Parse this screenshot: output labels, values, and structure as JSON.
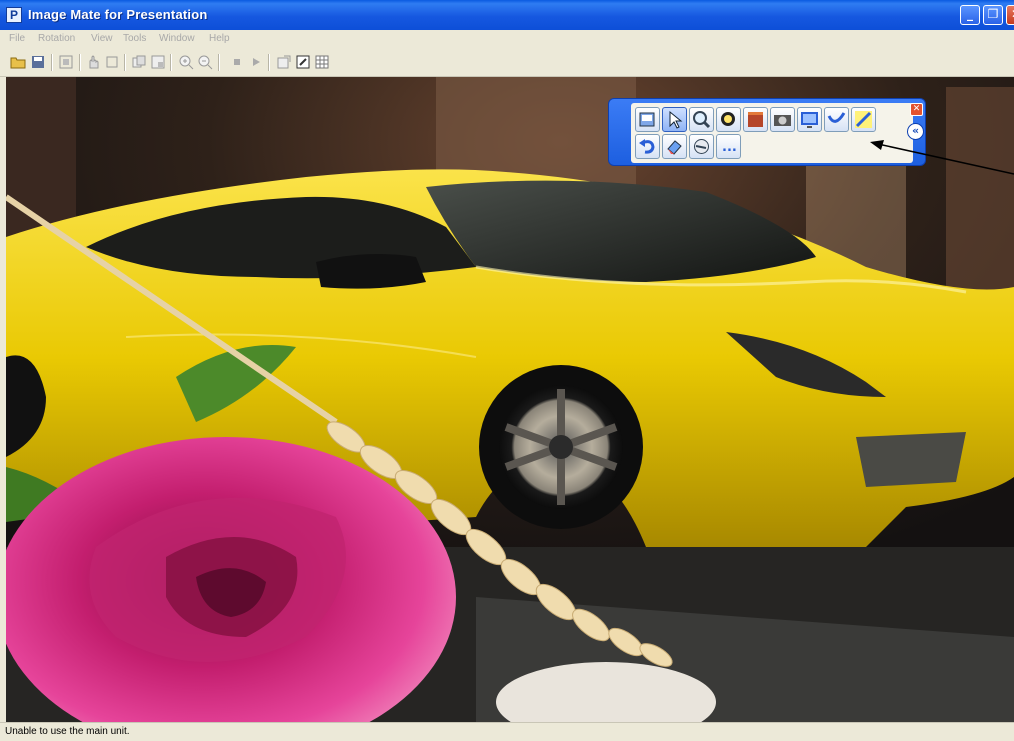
{
  "window": {
    "title": "Image Mate for Presentation",
    "app_icon_letter": "P"
  },
  "menu": {
    "items": [
      "File",
      "Rotation",
      "View",
      "Tools",
      "Window",
      "Help"
    ]
  },
  "toolbar": {
    "buttons": [
      "open-folder-icon",
      "save-icon",
      "freeze-icon",
      "hand-icon",
      "rectangle-icon",
      "compare-icon",
      "pip-icon",
      "zoom-in-icon",
      "zoom-out-icon",
      "stop-icon",
      "play-icon",
      "capture-icon",
      "edit-icon",
      "grid-icon"
    ]
  },
  "palette": {
    "row1": [
      "open-image-icon",
      "pointer-icon",
      "magnifier-icon",
      "spotlight-icon",
      "curtain-icon",
      "camera-icon",
      "screen-capture-icon",
      "pen-icon",
      "highlighter-icon"
    ],
    "row2": [
      "undo-icon",
      "eraser-icon",
      "clear-icon",
      "more-icon"
    ],
    "more_label": "...",
    "close_glyph": "✕",
    "collapse_glyph": "«"
  },
  "status": {
    "text": "Unable to use the main unit."
  },
  "colors": {
    "titlebar": "#1658e0",
    "car": "#f2d608",
    "rose": "#d6287f",
    "palette": "#2b6cee"
  }
}
